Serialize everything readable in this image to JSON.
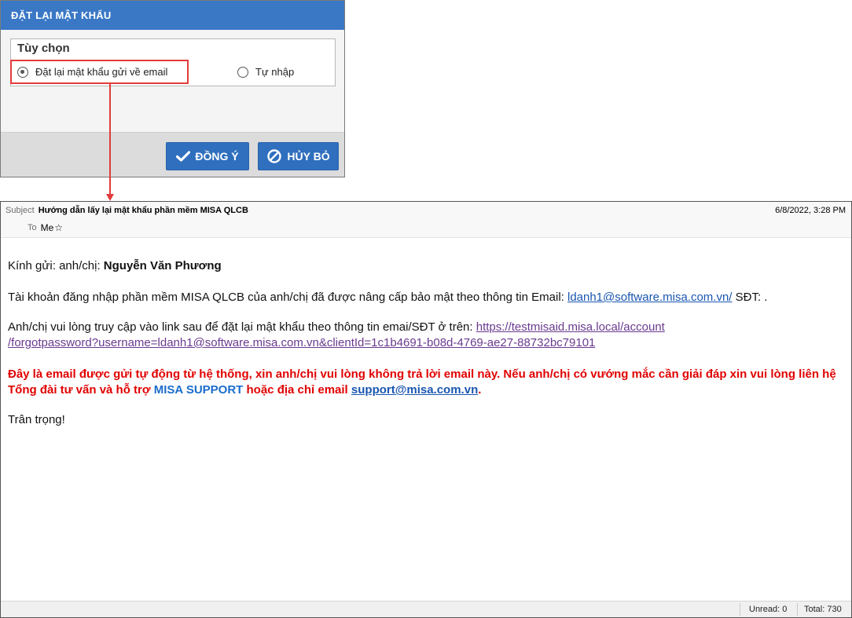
{
  "dialog": {
    "title": "ĐẶT LẠI MẬT KHẨU",
    "group_title": "Tùy chọn",
    "options": [
      {
        "label": "Đặt lại mật khẩu gửi về email",
        "selected": true
      },
      {
        "label": "Tự nhập",
        "selected": false
      }
    ],
    "ok_label": "ĐỒNG Ý",
    "cancel_label": "HỦY BỎ",
    "header_color": "#3a78c6",
    "button_color": "#2f6fbe",
    "highlight_color": "#e23b3b"
  },
  "email": {
    "subject_label": "Subject",
    "subject": "Hướng dẫn lấy lại mật khẩu phần mềm MISA QLCB",
    "date": "6/8/2022, 3:28 PM",
    "to_label": "To",
    "to": "Me",
    "body": {
      "greeting_prefix": "Kính gửi: anh/chị: ",
      "recipient_name": "Nguyễn Văn Phương",
      "account_text": "Tài khoản đăng nhập phần mềm MISA QLCB của anh/chị đã được nâng cấp bảo mật theo thông tin Email: ",
      "account_email": "ldanh1@software.misa.com.vn/",
      "phone_text": " SĐT: .",
      "link_intro": "Anh/chị vui lòng truy cập vào link sau để đặt lại mật khẩu theo thông tin emai/SĐT ở trên: ",
      "reset_link_part1": "https://testmisaid.misa.local/account",
      "reset_link_part2": "/forgotpassword?username=ldanh1@software.misa.com.vn&clientId=1c1b4691-b08d-4769-ae27-88732bc79101",
      "warning_text": "Đây là email được gửi tự động từ hệ thống, xin anh/chị vui lòng không trả lời email này. Nếu anh/chị có vướng mắc cần giải đáp xin vui lòng liên hệ Tổng đài tư vấn và hỗ trợ ",
      "support_name": "MISA SUPPORT",
      "warning_text2": " hoặc địa chỉ email ",
      "support_email": "support@misa.com.vn",
      "warning_end": ".",
      "closing": "Trân trọng!"
    },
    "status": {
      "unread": "Unread: 0",
      "total": "Total: 730"
    },
    "warning_color": "#e10000",
    "link_color": "#1a56b0"
  }
}
